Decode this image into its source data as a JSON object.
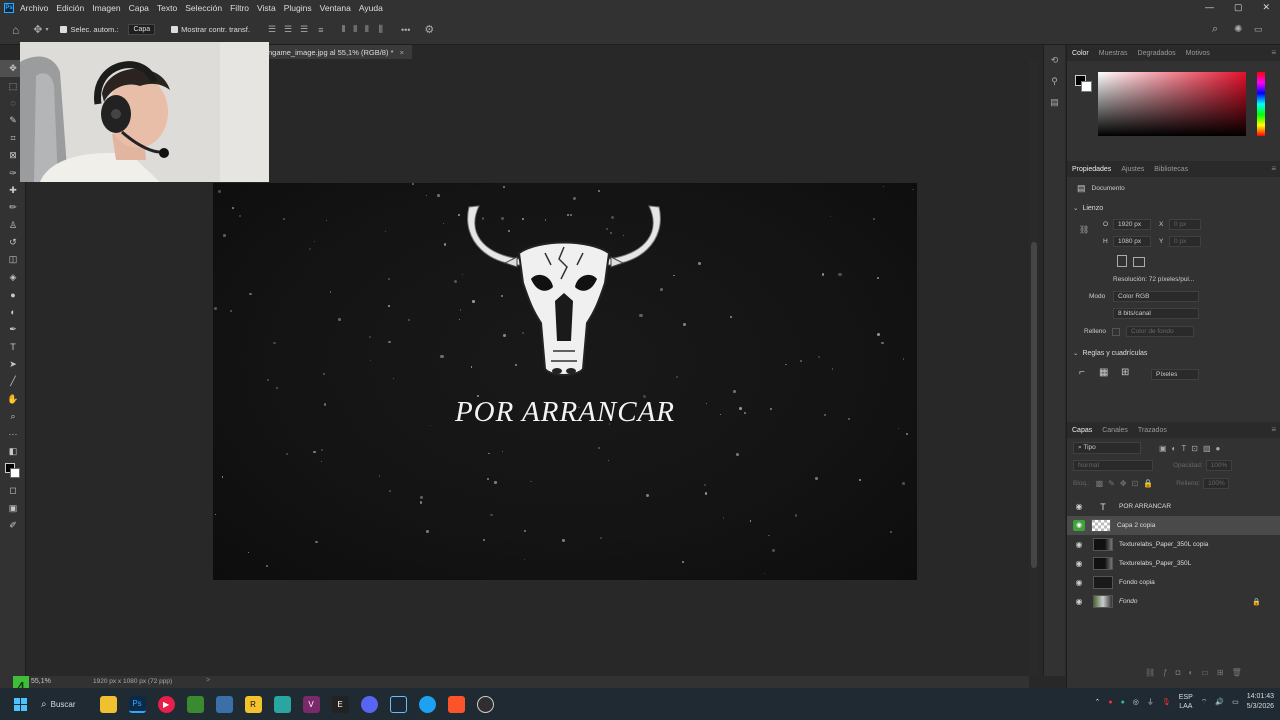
{
  "menubar": {
    "app_icon": "Ps",
    "items": [
      "Archivo",
      "Edición",
      "Imagen",
      "Capa",
      "Texto",
      "Selección",
      "Filtro",
      "Vista",
      "Plugins",
      "Ventana",
      "Ayuda"
    ],
    "window_controls": [
      "—",
      "▢",
      "✕"
    ]
  },
  "options": {
    "auto_select_label": "Selec. autom.:",
    "auto_select_target": "Capa",
    "show_transform_label": "Mostrar contr. transf.",
    "more": "•••"
  },
  "doc_tab": {
    "title": "ngame_image.jpg al 55,1% (RGB/8) *",
    "close": "×"
  },
  "canvas": {
    "title_text": "POR ARRANCAR"
  },
  "status": {
    "zoom": "55,1%",
    "doc_info": "1920 px x 1080 px (72 ppp)",
    "arrow": ">"
  },
  "color_panel": {
    "tabs": [
      "Color",
      "Muestras",
      "Degradados",
      "Motivos"
    ],
    "fg_color": "#000000",
    "bg_color": "#ffffff"
  },
  "properties": {
    "tabs": [
      "Propiedades",
      "Ajustes",
      "Bibliotecas"
    ],
    "document_label": "Documento",
    "canvas_header": "Lienzo",
    "width_label": "O",
    "width_value": "1920 px",
    "x_label": "X",
    "x_value": "0 px",
    "height_label": "H",
    "height_value": "1080 px",
    "y_label": "Y",
    "y_value": "0 px",
    "resolution": "Resolución: 72 píxeles/pul...",
    "mode_label": "Modo",
    "mode_value": "Color RGB",
    "bits_value": "8 bits/canal",
    "fill_label": "Relleno",
    "fill_value": "Color de fondo",
    "rulers_header": "Reglas y cuadrículas",
    "units_value": "Píxeles"
  },
  "layers_panel": {
    "tabs": [
      "Capas",
      "Canales",
      "Trazados"
    ],
    "filter_value": "Tipo",
    "blend_mode": "Normal",
    "opacity_label": "Opacidad:",
    "opacity_value": "100%",
    "lock_label": "Bloq.:",
    "fill_label": "Relleno:",
    "fill_value": "100%",
    "layers": [
      {
        "name": "POR ARRANCAR",
        "kind": "text"
      },
      {
        "name": "Capa 2 copia",
        "kind": "checker",
        "selected": true
      },
      {
        "name": "Texturelabs_Paper_350L copia",
        "kind": "texture"
      },
      {
        "name": "Texturelabs_Paper_350L",
        "kind": "texture"
      },
      {
        "name": "Fondo copia",
        "kind": "dark"
      },
      {
        "name": "Fondo",
        "kind": "image",
        "locked": true
      }
    ]
  },
  "taskbar": {
    "search_label": "Buscar",
    "lang_line1": "ESP",
    "lang_line2": "LAA",
    "time": "14:01:43",
    "date": "5/3/2026"
  },
  "watermark": "4"
}
